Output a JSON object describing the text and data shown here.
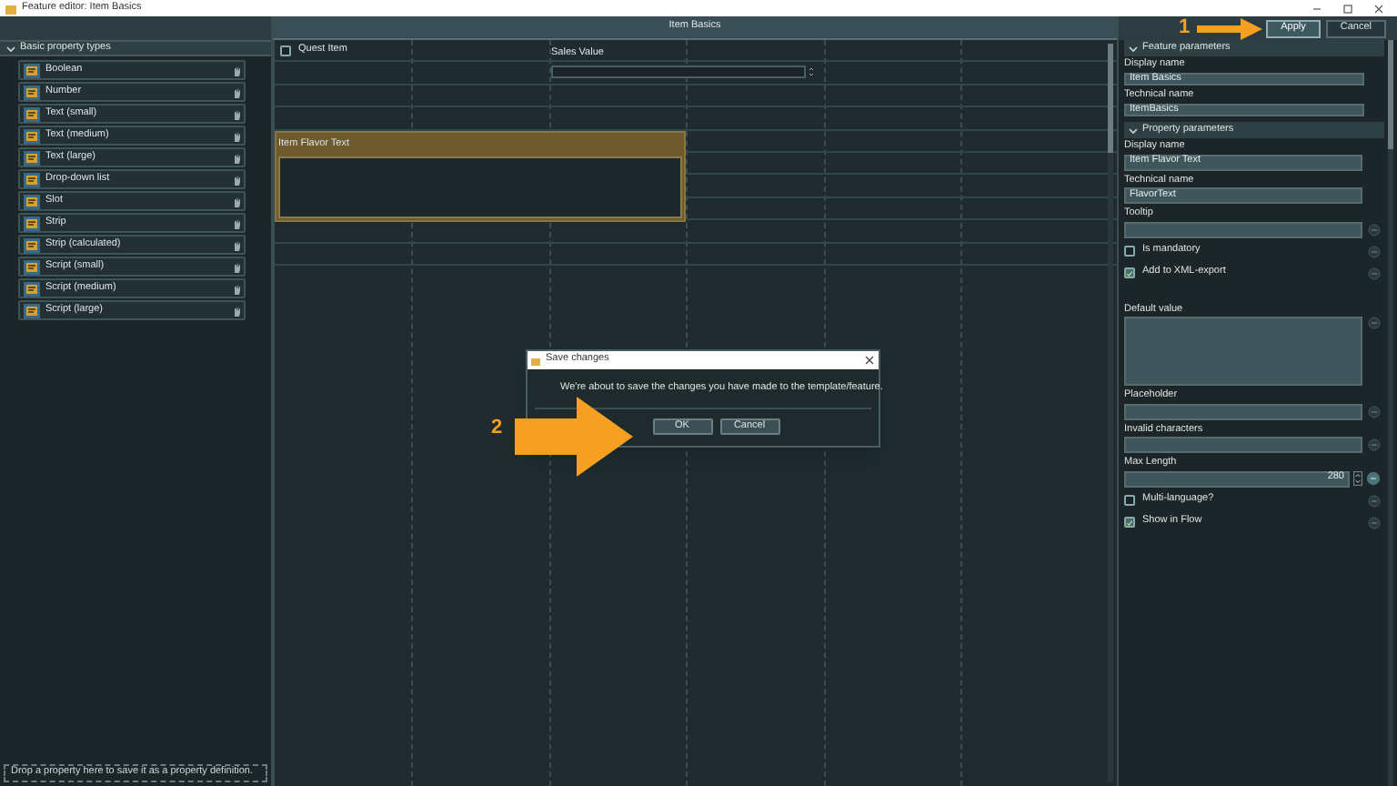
{
  "window": {
    "title": "Feature editor: Item Basics"
  },
  "actions": [
    {
      "label": "Apply",
      "kind": "primary"
    },
    {
      "label": "Cancel",
      "kind": "normal"
    }
  ],
  "left_panel": {
    "title": "Basic property types",
    "expanded": true,
    "items": [
      {
        "label": "Boolean"
      },
      {
        "label": "Number"
      },
      {
        "label": "Text (small)"
      },
      {
        "label": "Text (medium)"
      },
      {
        "label": "Text (large)"
      },
      {
        "label": "Drop-down list"
      },
      {
        "label": "Slot"
      },
      {
        "label": "Strip"
      },
      {
        "label": "Strip (calculated)"
      },
      {
        "label": "Script (small)"
      },
      {
        "label": "Script (medium)"
      },
      {
        "label": "Script (large)"
      }
    ],
    "drop_hint": "Drop a property here to save it as a property definition."
  },
  "canvas": {
    "title": "Item Basics",
    "quest_item": {
      "label": "Quest Item",
      "checked": false
    },
    "sales_value": {
      "label": "Sales Value"
    },
    "flavor_text": {
      "label": "Item Flavor Text",
      "selected": true
    }
  },
  "feature_parameters": {
    "title": "Feature parameters",
    "expanded": true,
    "fields": [
      {
        "label": "Display name",
        "value": "Item Basics"
      },
      {
        "label": "Technical name",
        "value": "ItemBasics"
      }
    ]
  },
  "property_parameters": {
    "title": "Property parameters",
    "expanded": true,
    "fields": [
      {
        "kind": "text",
        "label": "Display name",
        "value": "Item Flavor Text"
      },
      {
        "kind": "text",
        "label": "Technical name",
        "value": "FlavorText"
      },
      {
        "kind": "text",
        "label": "Tooltip",
        "reset": true
      },
      {
        "kind": "checkbox",
        "label": "Is mandatory",
        "checked": false
      },
      {
        "kind": "checkbox",
        "label": "Add to XML-export",
        "checked": true
      },
      {
        "kind": "textarea",
        "label": "Default value"
      },
      {
        "kind": "text",
        "label": "Placeholder",
        "reset": true
      },
      {
        "kind": "text",
        "label": "Invalid characters",
        "reset": true
      },
      {
        "kind": "number",
        "label": "Max Length",
        "value": "280"
      },
      {
        "kind": "checkbox",
        "label": "Multi-language?",
        "checked": false
      },
      {
        "kind": "checkbox",
        "label": "Show in Flow",
        "checked": true
      }
    ]
  },
  "dialog": {
    "title": "Save changes",
    "message": "We're about to save the changes you have made to the template/feature.",
    "buttons": [
      "OK",
      "Cancel"
    ]
  },
  "annotations": [
    {
      "label": "1"
    },
    {
      "label": "2"
    }
  ]
}
